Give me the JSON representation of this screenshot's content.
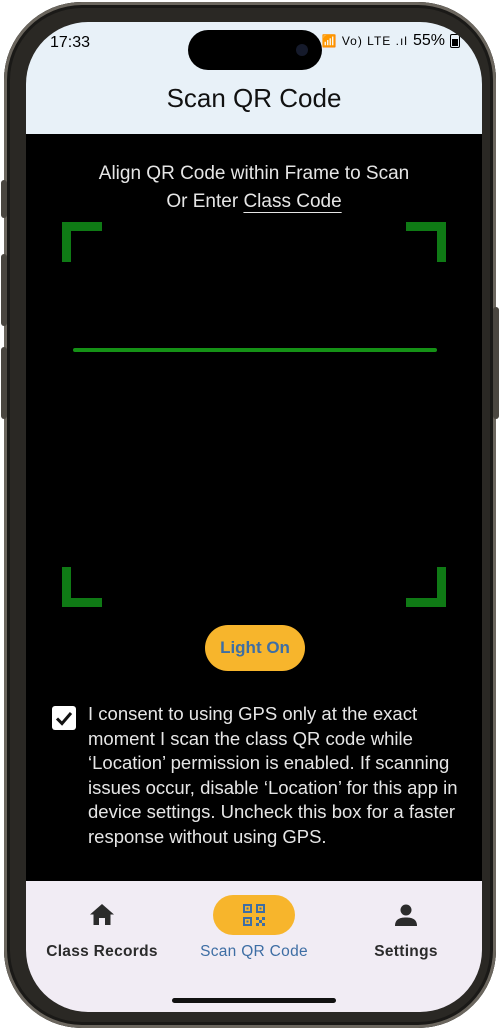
{
  "status_bar": {
    "time": "17:33",
    "icons_text": "🔇 📶 Vo) LTE .ıl",
    "battery": "55%"
  },
  "app_bar": {
    "title": "Scan QR Code"
  },
  "scanner": {
    "instruction_line1": "Align QR Code within Frame to Scan",
    "instruction_prefix": "Or Enter",
    "class_code_link": "Class Code",
    "frame_color": "#0f7a15",
    "scan_line_color": "#159116"
  },
  "light_button": {
    "label": "Light On",
    "color": "#f7b52c"
  },
  "consent": {
    "checked": true,
    "text": "I consent to using GPS only at the exact moment I scan the class QR code while ‘Location’ permission is enabled. If scanning issues occur, disable ‘Location’ for this app in device settings. Uncheck this box for a faster response without using GPS."
  },
  "bottom_nav": {
    "items": [
      {
        "label": "Class Records",
        "icon": "home-icon",
        "active": false
      },
      {
        "label": "Scan QR Code",
        "icon": "qr-code-icon",
        "active": true
      },
      {
        "label": "Settings",
        "icon": "person-icon",
        "active": false
      }
    ],
    "active_color": "#f7b52c"
  }
}
